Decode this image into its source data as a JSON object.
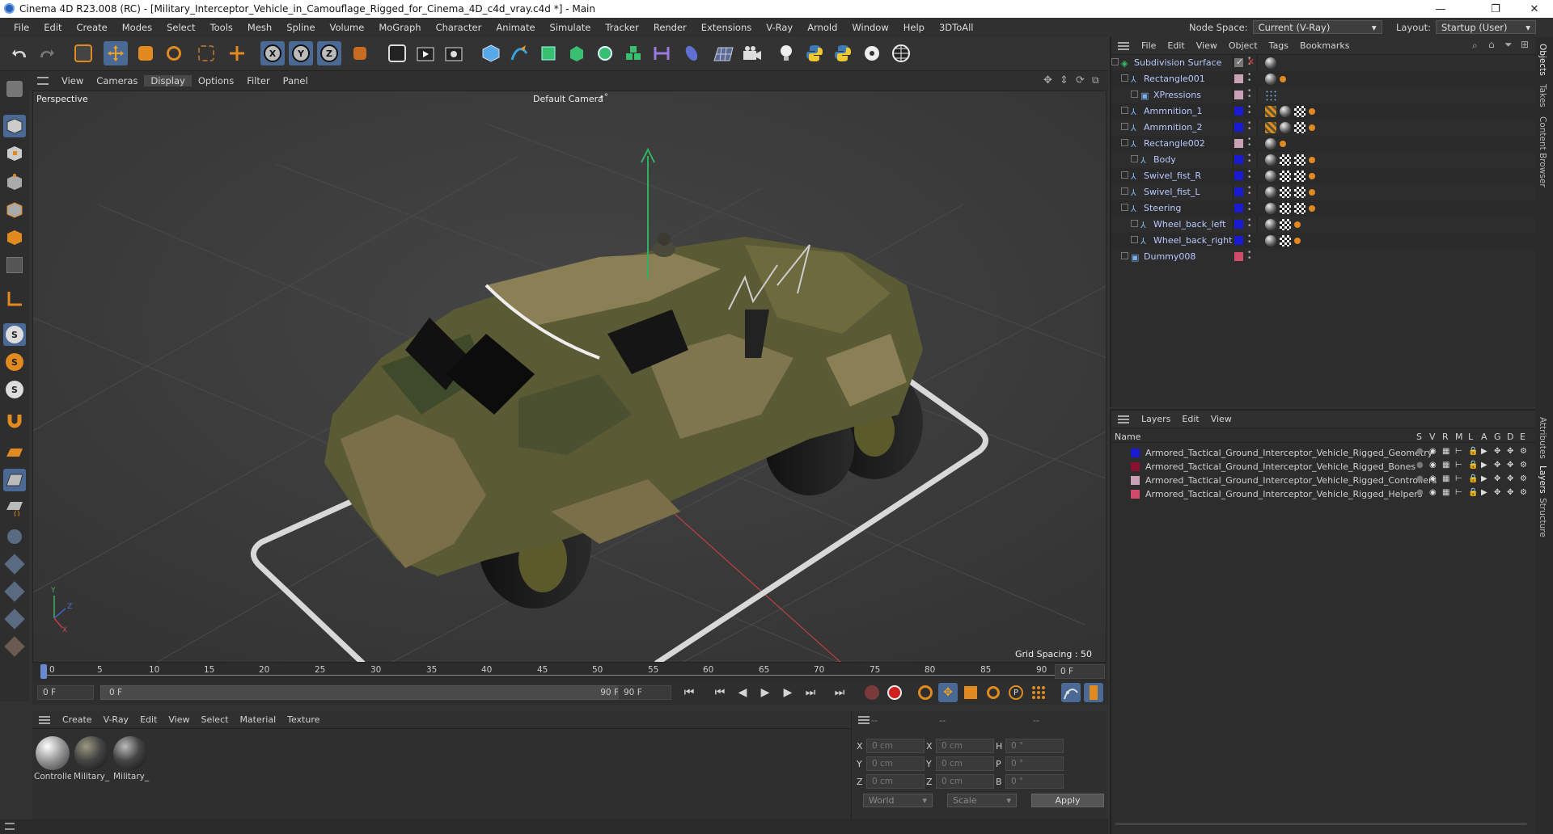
{
  "titlebar": {
    "title": "Cinema 4D R23.008 (RC) - [Military_Interceptor_Vehicle_in_Camouflage_Rigged_for_Cinema_4D_c4d_vray.c4d *] - Main",
    "minimize": "—",
    "maximize": "❐",
    "close": "✕"
  },
  "menubar": {
    "items": [
      "File",
      "Edit",
      "Create",
      "Modes",
      "Select",
      "Tools",
      "Mesh",
      "Spline",
      "Volume",
      "MoGraph",
      "Character",
      "Animate",
      "Simulate",
      "Tracker",
      "Render",
      "Extensions",
      "V-Ray",
      "Arnold",
      "Window",
      "Help",
      "3DToAll"
    ],
    "node_space_label": "Node Space:",
    "node_space_value": "Current (V-Ray)",
    "layout_label": "Layout:",
    "layout_value": "Startup (User)"
  },
  "viewport_menu": {
    "items": [
      "View",
      "Cameras",
      "Display",
      "Options",
      "Filter",
      "Panel"
    ],
    "active": "Display"
  },
  "viewport": {
    "view_name": "Perspective",
    "camera": "Default Camera",
    "camera_marker": "•°",
    "grid_spacing": "Grid Spacing : 50 cm",
    "axis_y": "Y",
    "axis_z": "Z",
    "axis_x": "X"
  },
  "timeline": {
    "ticks": [
      "0",
      "5",
      "10",
      "15",
      "20",
      "25",
      "30",
      "35",
      "40",
      "45",
      "50",
      "55",
      "60",
      "65",
      "70",
      "75",
      "80",
      "85",
      "90"
    ],
    "current_frame": "0 F"
  },
  "transport": {
    "start_field": "0 F",
    "range_start": "0 F",
    "range_end": "90 F",
    "end_field": "90 F"
  },
  "material_manager": {
    "menu": [
      "Create",
      "V-Ray",
      "Edit",
      "View",
      "Select",
      "Material",
      "Texture"
    ],
    "materials": [
      {
        "label": "Controlle"
      },
      {
        "label": "Military_"
      },
      {
        "label": "Military_"
      }
    ]
  },
  "coordinates": {
    "header_left": "--",
    "header_mid": "--",
    "header_right": "--",
    "rows": [
      {
        "a": "X",
        "av": "0 cm",
        "b": "X",
        "bv": "0 cm",
        "c": "H",
        "cv": "0 °"
      },
      {
        "a": "Y",
        "av": "0 cm",
        "b": "Y",
        "bv": "0 cm",
        "c": "P",
        "cv": "0 °"
      },
      {
        "a": "Z",
        "av": "0 cm",
        "b": "Z",
        "bv": "0 cm",
        "c": "B",
        "cv": "0 °"
      }
    ],
    "space_select": "World",
    "mode_select": "Scale",
    "apply": "Apply"
  },
  "object_manager": {
    "menu": [
      "File",
      "Edit",
      "View",
      "Object",
      "Tags",
      "Bookmarks"
    ],
    "objects": [
      {
        "name": "Subdivision Surface",
        "color": "#9a9a9a",
        "swatch": false
      },
      {
        "name": "Rectangle001",
        "color": "#c9a2b8",
        "swatch": true
      },
      {
        "name": "XPressions",
        "color": "#c9a2b8",
        "swatch": true
      },
      {
        "name": "Ammnition_1",
        "color": "#1a1ad0",
        "swatch": true
      },
      {
        "name": "Ammnition_2",
        "color": "#1a1ad0",
        "swatch": true
      },
      {
        "name": "Rectangle002",
        "color": "#c9a2b8",
        "swatch": true
      },
      {
        "name": "Body",
        "color": "#1a1ad0",
        "swatch": true
      },
      {
        "name": "Swivel_fist_R",
        "color": "#1a1ad0",
        "swatch": true
      },
      {
        "name": "Swivel_fist_L",
        "color": "#1a1ad0",
        "swatch": true
      },
      {
        "name": "Steering",
        "color": "#1a1ad0",
        "swatch": true
      },
      {
        "name": "Wheel_back_left",
        "color": "#1a1ad0",
        "swatch": true
      },
      {
        "name": "Wheel_back_right",
        "color": "#1a1ad0",
        "swatch": true
      },
      {
        "name": "Dummy008",
        "color": "#d04a6a",
        "swatch": true
      }
    ]
  },
  "layer_manager": {
    "menu": [
      "Layers",
      "Edit",
      "View"
    ],
    "columns": [
      "Name",
      "S",
      "V",
      "R",
      "M",
      "L",
      "A",
      "G",
      "D",
      "E"
    ],
    "layers": [
      {
        "name": "Armored_Tactical_Ground_Interceptor_Vehicle_Rigged_Geometry",
        "color": "#1a1ad0"
      },
      {
        "name": "Armored_Tactical_Ground_Interceptor_Vehicle_Rigged_Bones",
        "color": "#8a1030"
      },
      {
        "name": "Armored_Tactical_Ground_Interceptor_Vehicle_Rigged_Controllers",
        "color": "#c9a2b8"
      },
      {
        "name": "Armored_Tactical_Ground_Interceptor_Vehicle_Rigged_Helpers",
        "color": "#d04a6a"
      }
    ]
  },
  "right_tabs": [
    "Objects",
    "Takes",
    "Content Browser",
    "Attributes",
    "Layers",
    "Structure"
  ]
}
